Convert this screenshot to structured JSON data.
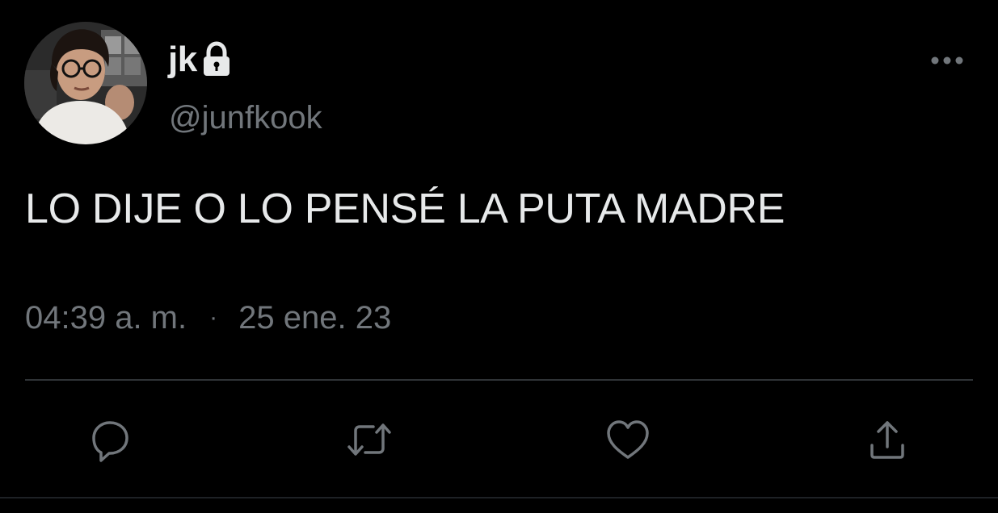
{
  "author": {
    "display_name": "jk",
    "handle": "@junfkook",
    "protected_icon": "lock-icon",
    "avatar_icon": "profile-photo"
  },
  "tweet": {
    "text": "LO DIJE O LO PENSÉ LA PUTA MADRE",
    "time": "04:39 a. m.",
    "separator": "·",
    "date": "25 ene. 23"
  },
  "actions": {
    "reply_icon": "reply-icon",
    "retweet_icon": "retweet-icon",
    "like_icon": "like-icon",
    "share_icon": "share-icon",
    "more_icon": "more-options-icon"
  },
  "colors": {
    "background": "#000000",
    "primary_text": "#e7e9ea",
    "secondary_text": "#71767b",
    "divider": "#2f3336"
  }
}
